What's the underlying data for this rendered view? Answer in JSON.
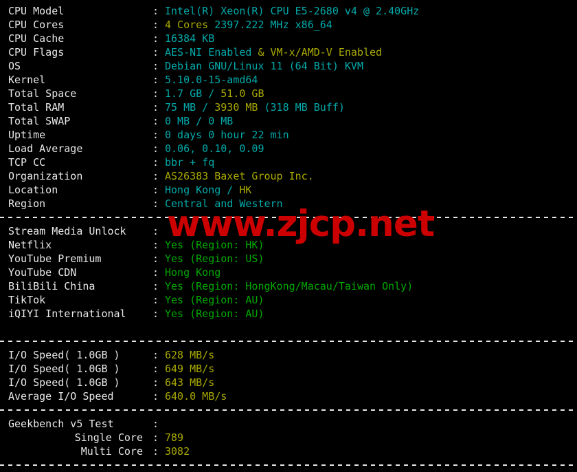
{
  "terminal": {
    "background_color": "#000000",
    "label_color": "#e8e8e8",
    "cyan_color": "#00aaaa",
    "yellow_color": "#aaaa00",
    "green_color": "#00aa00",
    "watermark_color": "#cc0000",
    "colon": ":"
  },
  "watermark": {
    "text": "www.zjcp.net"
  },
  "system_info": [
    {
      "label": "CPU Model",
      "parts": [
        {
          "text": "Intel(R) Xeon(R) CPU E5-2680 v4 @ 2.40GHz",
          "color": "cyan"
        }
      ]
    },
    {
      "label": "CPU Cores",
      "parts": [
        {
          "text": "4 Cores",
          "color": "yellow"
        },
        {
          "text": " 2397.222 MHz x86_64",
          "color": "cyan"
        }
      ]
    },
    {
      "label": "CPU Cache",
      "parts": [
        {
          "text": "16384 KB",
          "color": "cyan"
        }
      ]
    },
    {
      "label": "CPU Flags",
      "parts": [
        {
          "text": "AES-NI Enabled ",
          "color": "cyan"
        },
        {
          "text": "& VM-x/AMD-V Enabled",
          "color": "yellow"
        }
      ]
    },
    {
      "label": "OS",
      "parts": [
        {
          "text": "Debian GNU/Linux 11 (64 Bit) KVM",
          "color": "cyan"
        }
      ]
    },
    {
      "label": "Kernel",
      "parts": [
        {
          "text": "5.10.0-15-amd64",
          "color": "cyan"
        }
      ]
    },
    {
      "label": "Total Space",
      "parts": [
        {
          "text": "1.7 GB / ",
          "color": "cyan"
        },
        {
          "text": "51.0 GB",
          "color": "yellow"
        }
      ]
    },
    {
      "label": "Total RAM",
      "parts": [
        {
          "text": "75 MB / ",
          "color": "cyan"
        },
        {
          "text": "3930 MB",
          "color": "yellow"
        },
        {
          "text": " (318 MB Buff)",
          "color": "cyan"
        }
      ]
    },
    {
      "label": "Total SWAP",
      "parts": [
        {
          "text": "0 MB / 0 MB",
          "color": "cyan"
        }
      ]
    },
    {
      "label": "Uptime",
      "parts": [
        {
          "text": "0 days 0 hour 22 min",
          "color": "cyan"
        }
      ]
    },
    {
      "label": "Load Average",
      "parts": [
        {
          "text": "0.06, 0.10, 0.09",
          "color": "cyan"
        }
      ]
    },
    {
      "label": "TCP CC",
      "parts": [
        {
          "text": "bbr + fq",
          "color": "cyan"
        }
      ]
    },
    {
      "label": "Organization",
      "parts": [
        {
          "text": "AS26383 Baxet Group Inc.",
          "color": "yellow"
        }
      ]
    },
    {
      "label": "Location",
      "parts": [
        {
          "text": "Hong Kong / ",
          "color": "cyan"
        },
        {
          "text": "HK",
          "color": "yellow"
        }
      ]
    },
    {
      "label": "Region",
      "parts": [
        {
          "text": "Central and Western",
          "color": "cyan"
        }
      ]
    }
  ],
  "stream_media": {
    "header_label": "Stream Media Unlock",
    "header_value": "",
    "rows": [
      {
        "label": "Netflix",
        "parts": [
          {
            "text": "Yes (Region: HK)",
            "color": "green"
          }
        ]
      },
      {
        "label": "YouTube Premium",
        "parts": [
          {
            "text": "Yes (Region: US)",
            "color": "green"
          }
        ]
      },
      {
        "label": "YouTube CDN",
        "parts": [
          {
            "text": "Hong Kong",
            "color": "green"
          }
        ]
      },
      {
        "label": "BiliBili China",
        "parts": [
          {
            "text": "Yes (Region: HongKong/Macau/Taiwan Only)",
            "color": "green"
          }
        ]
      },
      {
        "label": "TikTok",
        "parts": [
          {
            "text": "Yes (Region: AU)",
            "color": "green"
          }
        ]
      },
      {
        "label": "iQIYI International",
        "parts": [
          {
            "text": "Yes (Region: AU)",
            "color": "green"
          }
        ]
      }
    ]
  },
  "io_speed": {
    "rows": [
      {
        "label": "I/O Speed( 1.0GB )",
        "parts": [
          {
            "text": "628 MB/s",
            "color": "yellow"
          }
        ]
      },
      {
        "label": "I/O Speed( 1.0GB )",
        "parts": [
          {
            "text": "649 MB/s",
            "color": "yellow"
          }
        ]
      },
      {
        "label": "I/O Speed( 1.0GB )",
        "parts": [
          {
            "text": "643 MB/s",
            "color": "yellow"
          }
        ]
      },
      {
        "label": "Average I/O Speed",
        "parts": [
          {
            "text": "640.0 MB/s",
            "color": "yellow"
          }
        ]
      }
    ]
  },
  "geekbench": {
    "title_label": "Geekbench v5 Test",
    "title_value": "",
    "rows": [
      {
        "label": "Single Core",
        "indent": true,
        "parts": [
          {
            "text": "789",
            "color": "yellow"
          }
        ]
      },
      {
        "label": "Multi Core",
        "indent": true,
        "parts": [
          {
            "text": "3082",
            "color": "yellow"
          }
        ]
      }
    ]
  }
}
